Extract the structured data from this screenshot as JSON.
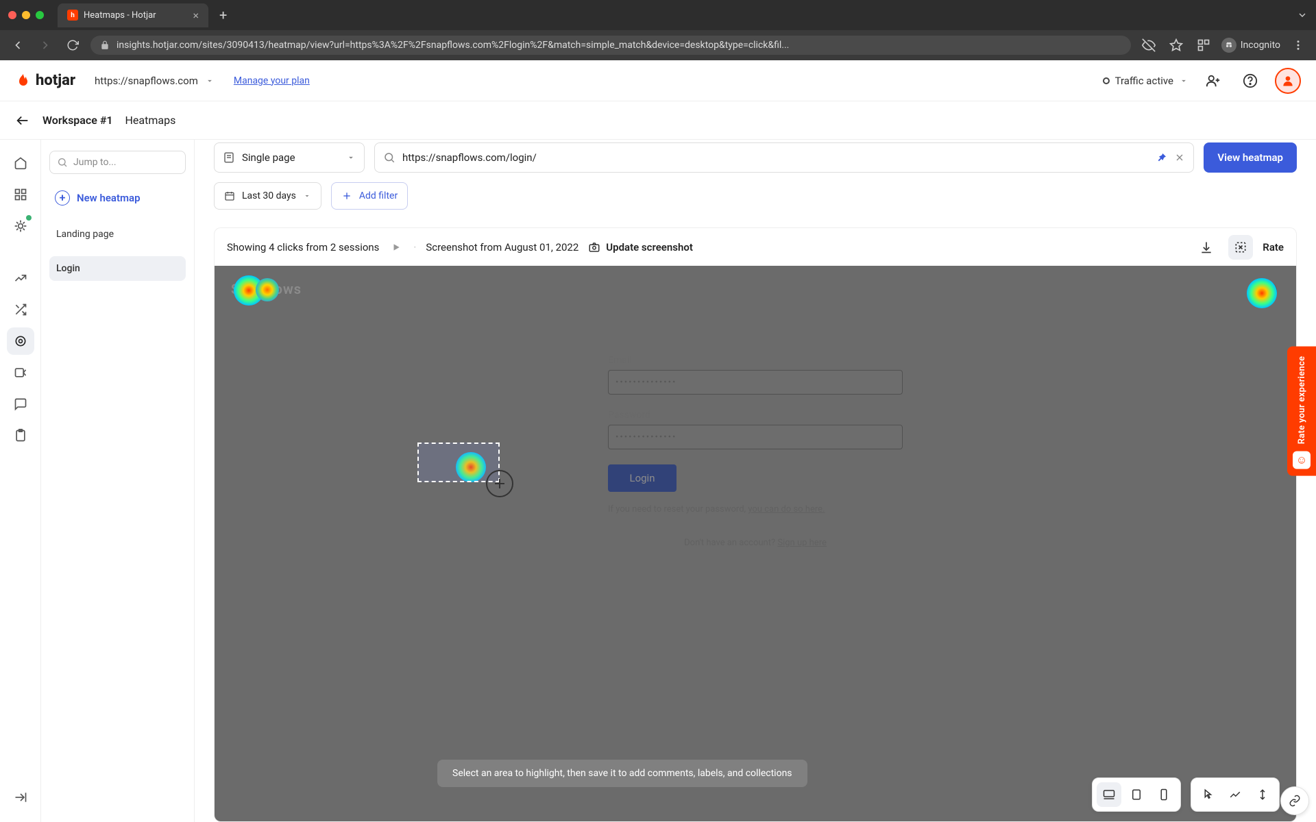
{
  "browser": {
    "tab_title": "Heatmaps - Hotjar",
    "url": "insights.hotjar.com/sites/3090413/heatmap/view?url=https%3A%2F%2Fsnapflows.com%2Flogin%2F&match=simple_match&device=desktop&type=click&fil...",
    "incognito_label": "Incognito"
  },
  "header": {
    "brand": "hotjar",
    "site": "https://snapflows.com",
    "manage_plan": "Manage your plan",
    "traffic": "Traffic active"
  },
  "crumbs": {
    "workspace": "Workspace #1",
    "section": "Heatmaps"
  },
  "sidebar": {
    "jump_placeholder": "Jump to...",
    "new_heatmap": "New heatmap",
    "items": [
      {
        "label": "Landing page"
      },
      {
        "label": "Login"
      }
    ]
  },
  "controls": {
    "match_mode": "Single page",
    "url_value": "https://snapflows.com/login/",
    "view_btn": "View heatmap",
    "date_range": "Last 30 days",
    "add_filter": "Add filter"
  },
  "info": {
    "summary": "Showing 4 clicks from 2 sessions",
    "screenshot_date": "Screenshot from August 01, 2022",
    "update": "Update screenshot",
    "rate": "Rate"
  },
  "mock": {
    "logo": "Snapflows",
    "email_label": "Email",
    "password_label": "Password",
    "login_btn": "Login",
    "reset_prefix": "If you need to reset your password, ",
    "reset_link": "you can do so here.",
    "signup_prefix": "Don't have an account? ",
    "signup_link": "Sign up here"
  },
  "hint": "Select an area to highlight, then save it to add comments, labels, and collections",
  "feedback_tab": "Rate your experience",
  "colors": {
    "brand": "#ff3c00",
    "primary": "#3b5bdb"
  }
}
